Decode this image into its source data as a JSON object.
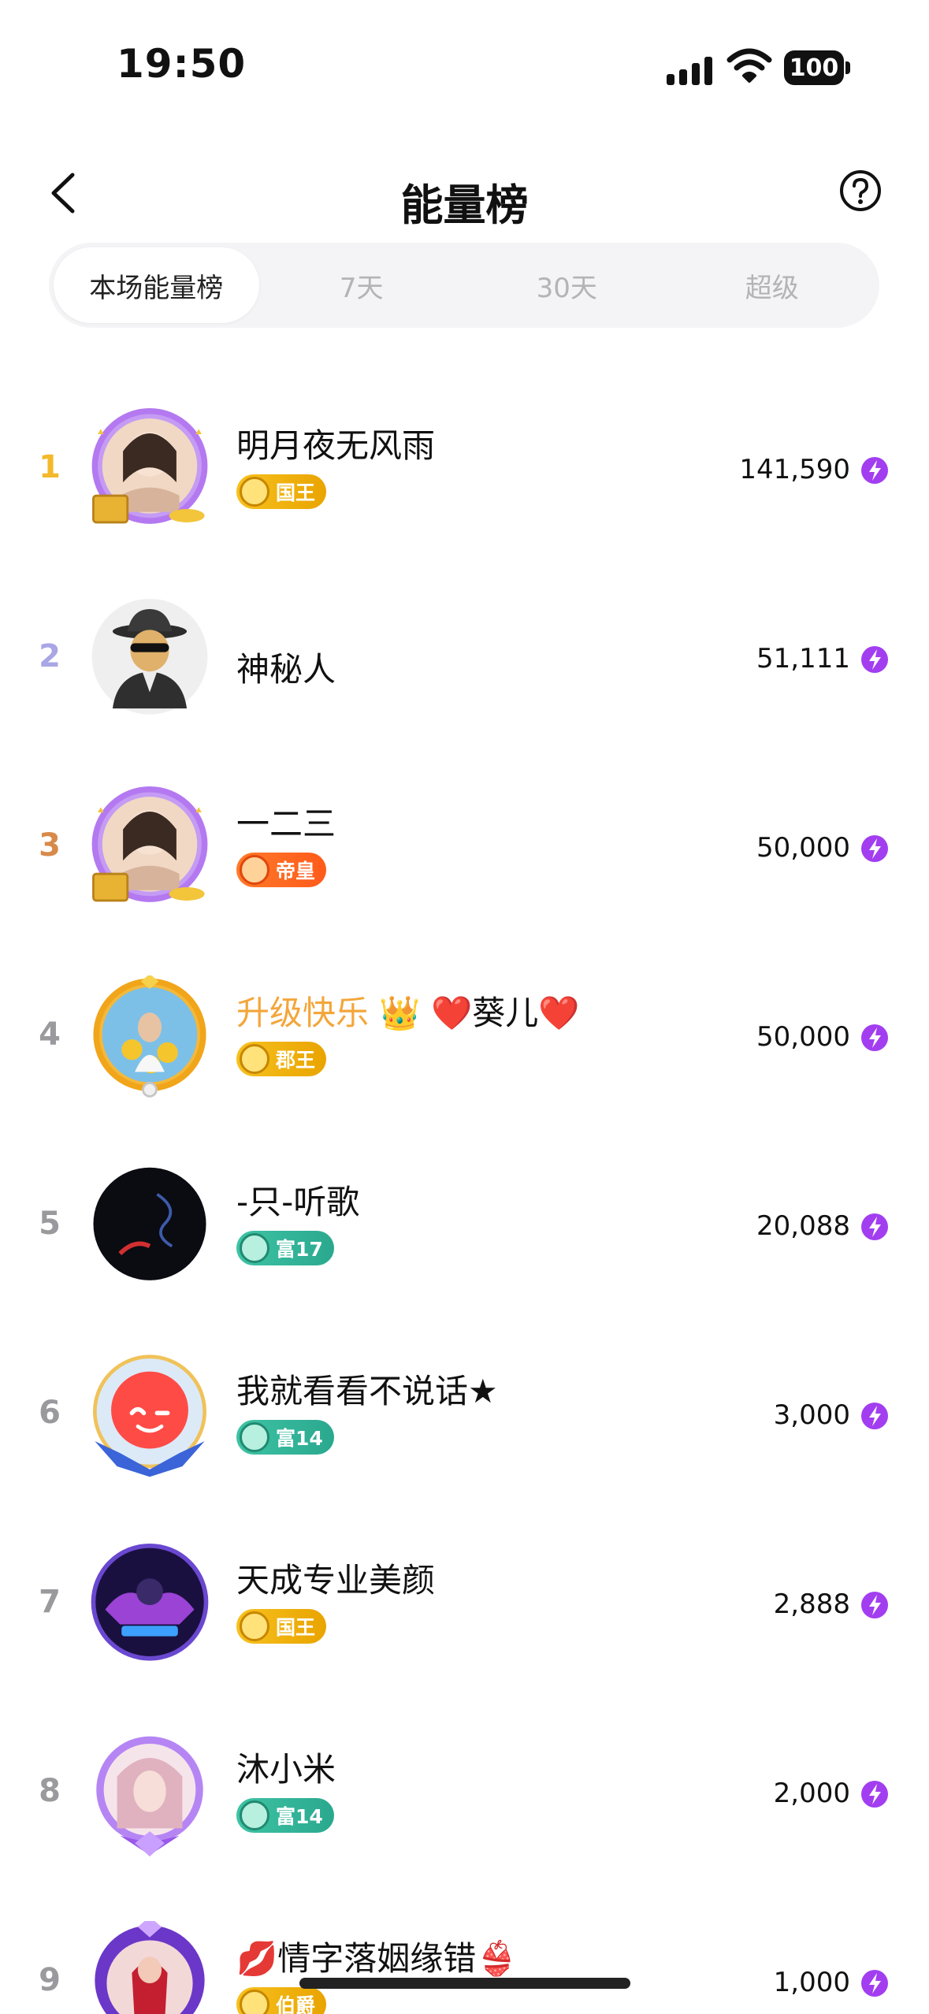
{
  "status_bar": {
    "time": "19:50",
    "battery": "100"
  },
  "header": {
    "title": "能量榜"
  },
  "tabs": [
    {
      "label": "本场能量榜",
      "active": true
    },
    {
      "label": "7天",
      "active": false
    },
    {
      "label": "30天",
      "active": false
    },
    {
      "label": "超级",
      "active": false
    }
  ],
  "rank_colors": {
    "1": "#f3b92a",
    "2": "#a9a6e6",
    "3": "#d88a4a",
    "default": "#9a9a9e"
  },
  "energy_color": "#a23ef0",
  "rows": [
    {
      "rank": "1",
      "name": "明月夜无风雨",
      "badge": "国王",
      "badge_type": "gold",
      "score": "141,590",
      "avatar": "card-avatar-purple"
    },
    {
      "rank": "2",
      "name": "神秘人",
      "badge": "",
      "badge_type": "",
      "score": "51,111",
      "avatar": "mystery-man"
    },
    {
      "rank": "3",
      "name": "一二三",
      "badge": "帝皇",
      "badge_type": "orange",
      "score": "50,000",
      "avatar": "card-avatar-purple"
    },
    {
      "rank": "4",
      "name": "升级快乐",
      "name_suffix": "❤️葵儿❤️",
      "badge": "郡王",
      "badge_type": "gold",
      "score": "50,000",
      "avatar": "gold-frame"
    },
    {
      "rank": "5",
      "name": "-只-听歌",
      "badge": "富17",
      "badge_type": "teal",
      "score": "20,088",
      "avatar": "dark-smoke"
    },
    {
      "rank": "6",
      "name": "我就看看不说话★",
      "badge": "富14",
      "badge_type": "teal",
      "score": "3,000",
      "avatar": "red-wink"
    },
    {
      "rank": "7",
      "name": "天成专业美颜",
      "badge": "国王",
      "badge_type": "gold",
      "score": "2,888",
      "avatar": "purple-night"
    },
    {
      "rank": "8",
      "name": "沐小米",
      "badge": "富14",
      "badge_type": "teal",
      "score": "2,000",
      "avatar": "purple-frame"
    },
    {
      "rank": "9",
      "name": "💋情字落姻缘错👙",
      "badge": "伯爵",
      "badge_type": "gold",
      "score": "1,000",
      "avatar": "purple-crest"
    }
  ]
}
